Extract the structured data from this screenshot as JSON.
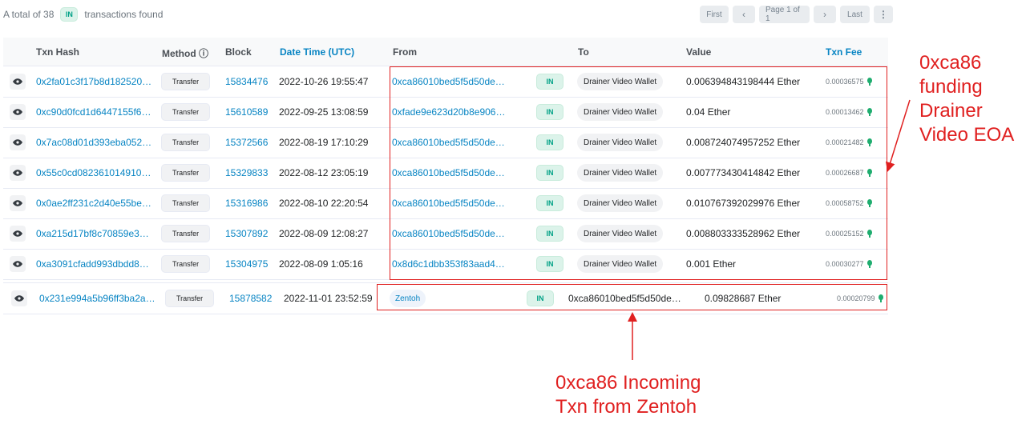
{
  "summary": {
    "lead": "A total of 38",
    "badge": "IN",
    "trail": "transactions found"
  },
  "pager": {
    "first": "First",
    "prev": "‹",
    "page": "Page 1 of 1",
    "next": "›",
    "last": "Last",
    "more": "⋮"
  },
  "columns": {
    "hash": "Txn Hash",
    "method": "Method ⓘ",
    "block": "Block",
    "datetime": "Date Time (UTC)",
    "from": "From",
    "to": "To",
    "value": "Value",
    "fee": "Txn Fee"
  },
  "rows": [
    {
      "hash": "0x2fa01c3f17b8d182520…",
      "method": "Transfer",
      "block": "15834476",
      "datetime": "2022-10-26 19:55:47",
      "from": "0xca86010bed5f5d50de…",
      "dir": "IN",
      "to": "Drainer Video Wallet",
      "value": "0.006394843198444 Ether",
      "fee": "0.00036575"
    },
    {
      "hash": "0xc90d0fcd1d6447155f6…",
      "method": "Transfer",
      "block": "15610589",
      "datetime": "2022-09-25 13:08:59",
      "from": "0xfade9e623d20b8e906…",
      "dir": "IN",
      "to": "Drainer Video Wallet",
      "value": "0.04 Ether",
      "fee": "0.00013462"
    },
    {
      "hash": "0x7ac08d01d393eba052…",
      "method": "Transfer",
      "block": "15372566",
      "datetime": "2022-08-19 17:10:29",
      "from": "0xca86010bed5f5d50de…",
      "dir": "IN",
      "to": "Drainer Video Wallet",
      "value": "0.008724074957252 Ether",
      "fee": "0.00021482"
    },
    {
      "hash": "0x55c0cd082361014910…",
      "method": "Transfer",
      "block": "15329833",
      "datetime": "2022-08-12 23:05:19",
      "from": "0xca86010bed5f5d50de…",
      "dir": "IN",
      "to": "Drainer Video Wallet",
      "value": "0.007773430414842 Ether",
      "fee": "0.00026687"
    },
    {
      "hash": "0x0ae2ff231c2d40e55be…",
      "method": "Transfer",
      "block": "15316986",
      "datetime": "2022-08-10 22:20:54",
      "from": "0xca86010bed5f5d50de…",
      "dir": "IN",
      "to": "Drainer Video Wallet",
      "value": "0.010767392029976 Ether",
      "fee": "0.00058752"
    },
    {
      "hash": "0xa215d17bf8c70859e3…",
      "method": "Transfer",
      "block": "15307892",
      "datetime": "2022-08-09 12:08:27",
      "from": "0xca86010bed5f5d50de…",
      "dir": "IN",
      "to": "Drainer Video Wallet",
      "value": "0.008803333528962 Ether",
      "fee": "0.00025152"
    },
    {
      "hash": "0xa3091cfadd993dbdd8…",
      "method": "Transfer",
      "block": "15304975",
      "datetime": "2022-08-09 1:05:16",
      "from": "0x8d6c1dbb353f83aad4…",
      "dir": "IN",
      "to": "Drainer Video Wallet",
      "value": "0.001 Ether",
      "fee": "0.00030277"
    }
  ],
  "extra_row": {
    "hash": "0x231e994a5b96ff3ba2a…",
    "method": "Transfer",
    "block": "15878582",
    "datetime": "2022-11-01 23:52:59",
    "from": "Zentoh",
    "dir": "IN",
    "to": "0xca86010bed5f5d50de…",
    "value": "0.09828687 Ether",
    "fee": "0.00020799"
  },
  "annotations": {
    "right": "0xca86\nfunding\nDrainer\nVideo EOA",
    "bottom": "0xca86 Incoming\nTxn from Zentoh"
  },
  "colors": {
    "annotation": "#e02020",
    "link": "#0784c3",
    "in_badge": "#00a186",
    "gas_icon": "#1fad6f"
  },
  "icons": {
    "view": "eye-icon",
    "gas": "gas-icon",
    "info": "info-icon"
  }
}
